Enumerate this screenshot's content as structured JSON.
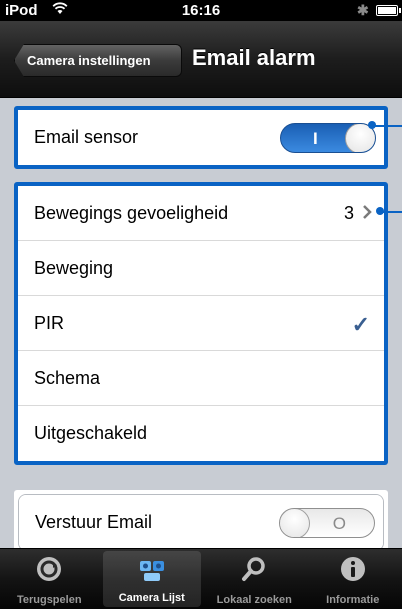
{
  "status_bar": {
    "carrier": "iPod",
    "time": "16:16",
    "bluetooth": "✱"
  },
  "nav": {
    "back_label": "Camera instellingen",
    "title": "Email alarm"
  },
  "email_sensor": {
    "label": "Email sensor",
    "toggle_on": true,
    "toggle_glyph": "I"
  },
  "sensitivity": {
    "label": "Bewegings gevoeligheid",
    "value": "3"
  },
  "options": [
    {
      "label": "Beweging",
      "checked": false
    },
    {
      "label": "PIR",
      "checked": true
    },
    {
      "label": "Schema",
      "checked": false
    },
    {
      "label": "Uitgeschakeld",
      "checked": false
    }
  ],
  "send_email": {
    "label": "Verstuur Email",
    "toggle_on": false,
    "toggle_glyph": "O"
  },
  "tabs": [
    {
      "label": "Terugspelen",
      "icon": "playback-icon",
      "active": false
    },
    {
      "label": "Camera Lijst",
      "icon": "camera-list-icon",
      "active": true
    },
    {
      "label": "Lokaal zoeken",
      "icon": "search-icon",
      "active": false
    },
    {
      "label": "Informatie",
      "icon": "info-icon",
      "active": false
    }
  ],
  "colors": {
    "highlight": "#0a63c4",
    "checkmark": "#3a5f91",
    "toggle_on": "#1a5fb4"
  }
}
